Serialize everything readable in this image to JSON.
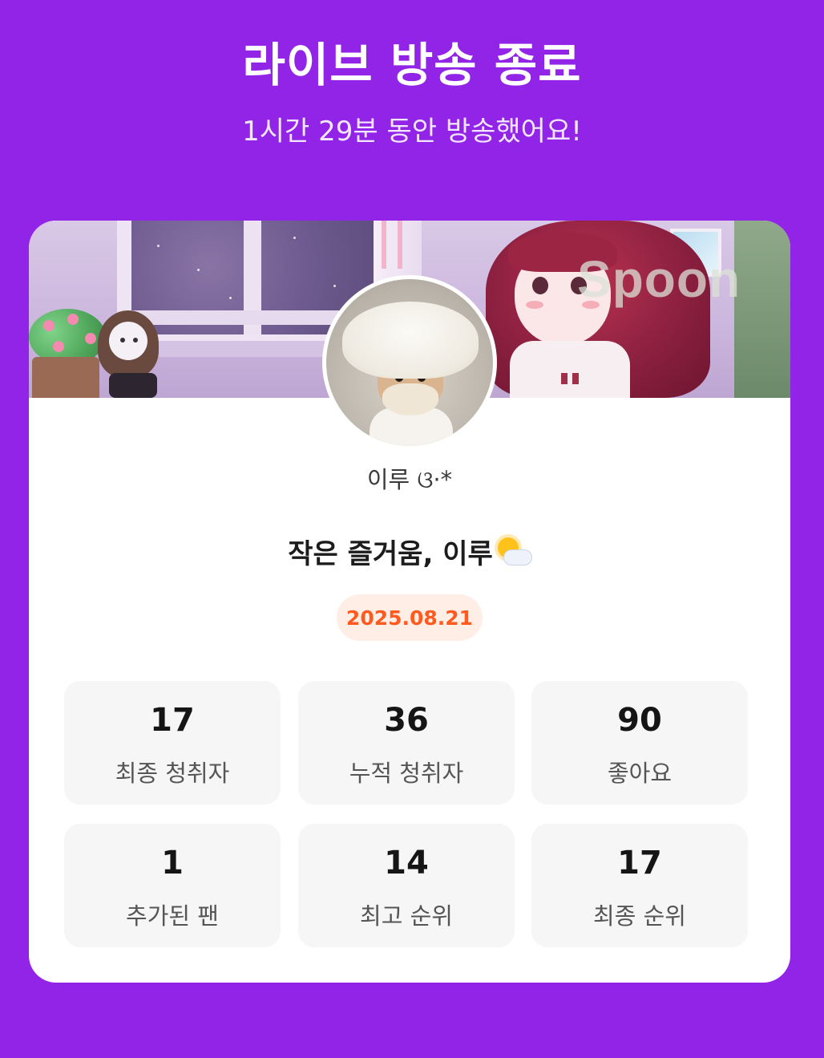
{
  "header": {
    "title": "라이브 방송 종료",
    "subtitle": "1시간 29분 동안 방송했어요!"
  },
  "card": {
    "banner": {
      "watermark": "Spoon"
    },
    "dj": {
      "nickname": "이루 ଓ·*"
    },
    "room": {
      "title": "작은 즐거움, 이루",
      "title_emoji": "sun-behind-cloud-icon"
    },
    "date": "2025.08.21",
    "stats": [
      {
        "value": "17",
        "label": "최종 청취자"
      },
      {
        "value": "36",
        "label": "누적 청취자"
      },
      {
        "value": "90",
        "label": "좋아요"
      },
      {
        "value": "1",
        "label": "추가된 팬"
      },
      {
        "value": "14",
        "label": "최고 순위"
      },
      {
        "value": "17",
        "label": "최종 순위"
      }
    ]
  },
  "colors": {
    "background": "#9124e6",
    "date_text": "#ff5a1f",
    "date_badge_bg": "#ffeee6",
    "stat_tile_bg": "#f6f6f6"
  }
}
